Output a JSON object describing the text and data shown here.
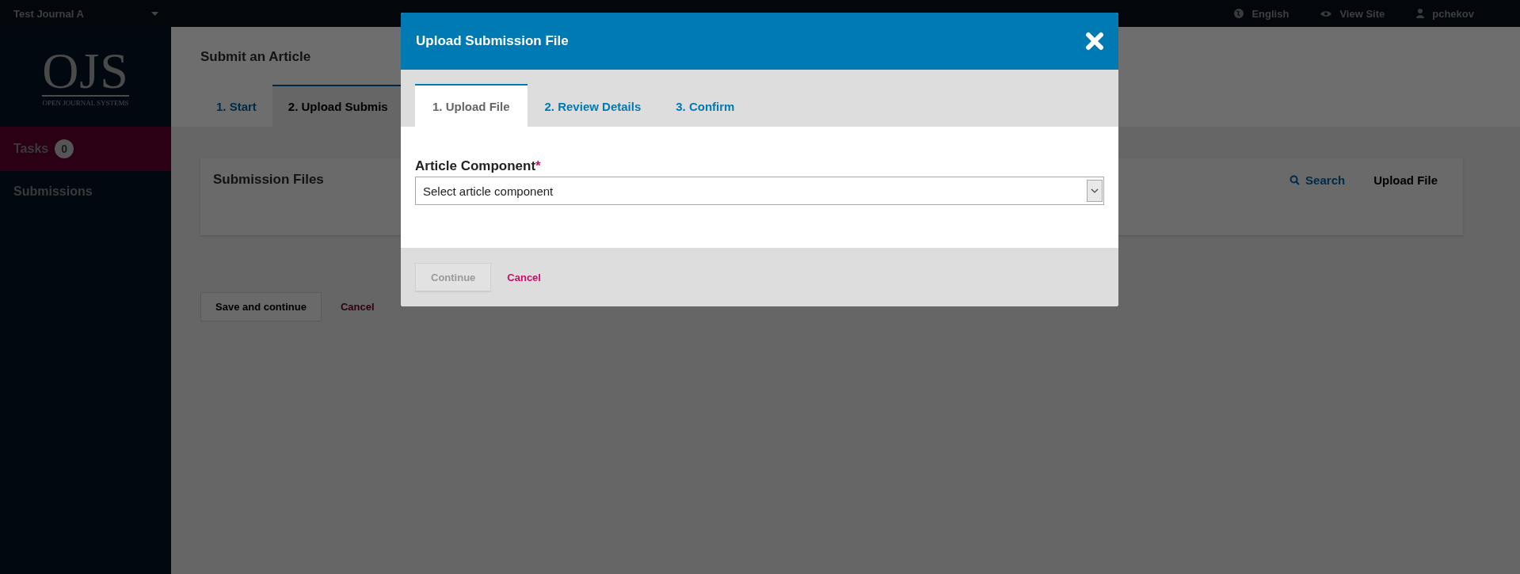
{
  "top_bar": {
    "journal": "Test Journal A",
    "links": [
      {
        "kind": "language",
        "label": "English"
      },
      {
        "kind": "view",
        "label": "View Site"
      },
      {
        "kind": "user",
        "label": "pchekov"
      }
    ]
  },
  "sidebar": {
    "logo": {
      "letters": "OJS",
      "tagline": "OPEN JOURNAL SYSTEMS"
    },
    "items": [
      {
        "label": "Tasks",
        "badge": "0",
        "selected": true
      },
      {
        "label": "Submissions",
        "selected": false
      }
    ]
  },
  "page": {
    "title": "Submit an Article",
    "tabs": [
      {
        "label": "1. Start",
        "selected": false
      },
      {
        "label": "2. Upload Submis",
        "selected": true
      }
    ],
    "panel": {
      "title": "Submission Files",
      "actions": [
        {
          "kind": "search",
          "label": "Search"
        },
        {
          "kind": "upload",
          "label": "Upload File"
        }
      ]
    },
    "save": "Save and continue",
    "cancel": "Cancel"
  },
  "modal": {
    "title": "Upload Submission File",
    "tabs": [
      {
        "label": "1. Upload File",
        "selected": true
      },
      {
        "label": "2. Review Details",
        "selected": false
      },
      {
        "label": "3. Confirm",
        "selected": false
      }
    ],
    "field": {
      "label": "Article Component",
      "required_mark": "*",
      "value": "Select article component"
    },
    "continue": {
      "label": "Continue",
      "disabled": true
    },
    "cancel": "Cancel"
  }
}
